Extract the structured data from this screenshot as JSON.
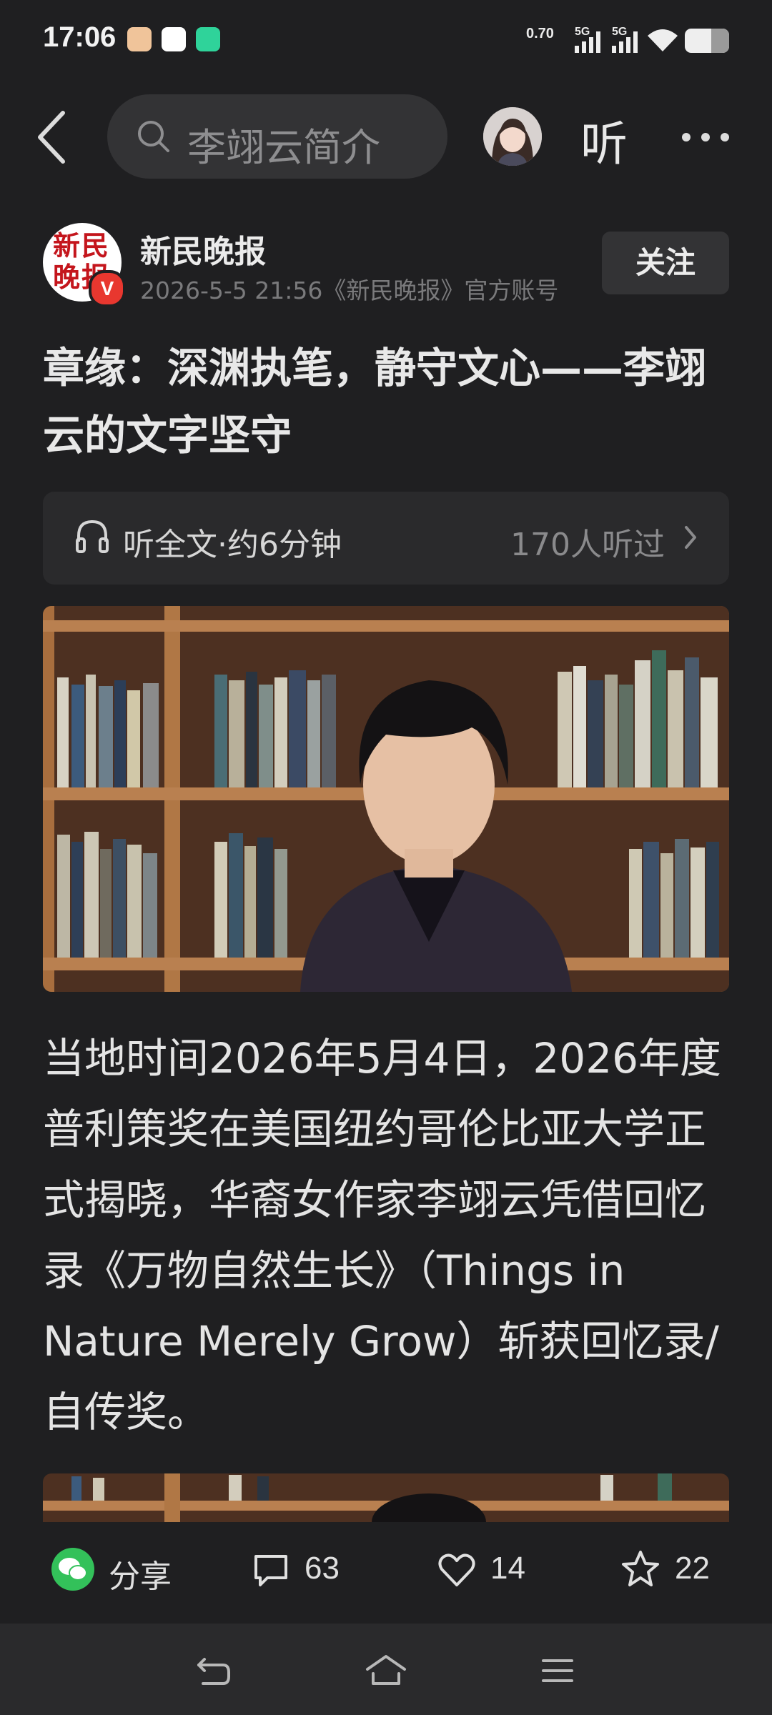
{
  "status_bar": {
    "time": "17:06",
    "net_speed": "0.70",
    "signal1_label": "5G",
    "signal2_label": "5G",
    "battery_level": 0.6
  },
  "nav": {
    "search_placeholder": "李翊云简介",
    "listen_label": "听"
  },
  "author": {
    "logo_text": "新民晚报",
    "verified_badge": "V",
    "name": "新民晚报",
    "meta": "2026-5-5 21:56《新民晚报》官方账号",
    "follow_label": "关注"
  },
  "article": {
    "title": "章缘：深渊执笔，静守文心——李翊云的文字坚守",
    "listen_card": {
      "label": "听全文·约6分钟",
      "count": "170人听过"
    },
    "paragraph": "当地时间2026年5月4日，2026年度普利策奖在美国纽约哥伦比亚大学正式揭晓，华裔女作家李翊云凭借回忆录《万物自然生长》（Things in Nature Merely Grow）斩获回忆录/自传奖。"
  },
  "actions": {
    "share_label": "分享",
    "comments": "63",
    "likes": "14",
    "favorites": "22"
  },
  "colors": {
    "background": "#1f1f21",
    "surface": "#333335",
    "card": "#2a2a2c",
    "wechat_green": "#33c15a",
    "logo_red": "#c4151c",
    "verified_red": "#e8372f"
  }
}
